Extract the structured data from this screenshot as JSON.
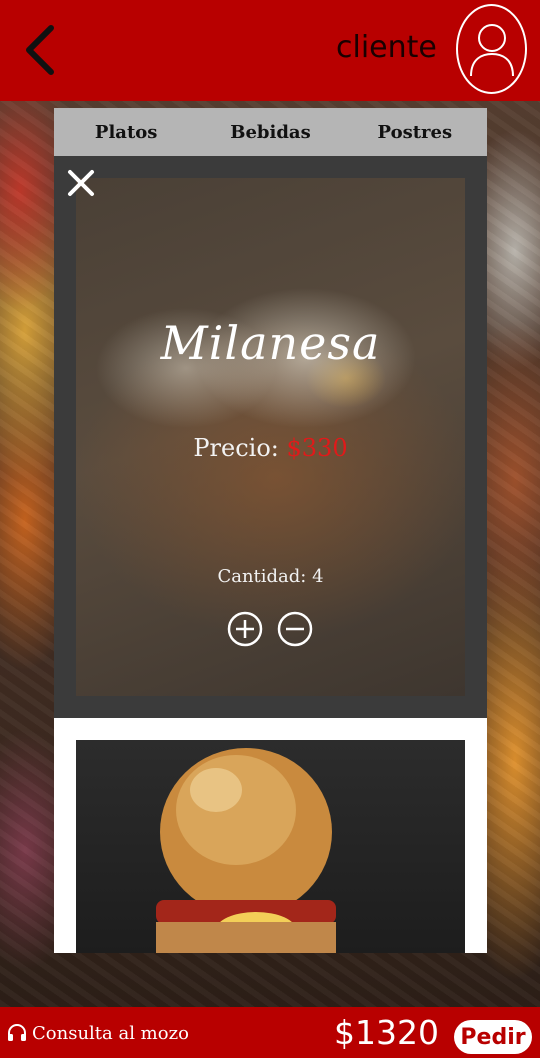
{
  "header": {
    "client_label": "cliente",
    "back_icon": "chevron-left-icon",
    "avatar_icon": "user-icon",
    "color": "#b80000"
  },
  "tabs": [
    {
      "label": "Platos"
    },
    {
      "label": "Bebidas"
    },
    {
      "label": "Postres"
    }
  ],
  "detail": {
    "dish_name": "Milanesa",
    "price_label": "Precio:",
    "price_value": "$330",
    "quantity_text": "Cantidad: 4",
    "close_icon": "close-icon",
    "plus_icon": "plus-circle-icon",
    "minus_icon": "minus-circle-icon"
  },
  "bottom": {
    "consult_label": "Consulta al mozo",
    "consult_icon": "headset-icon",
    "total": "$1320",
    "order_label": "Pedir"
  },
  "colors": {
    "accent": "#b80000",
    "price": "#e01a1a"
  }
}
